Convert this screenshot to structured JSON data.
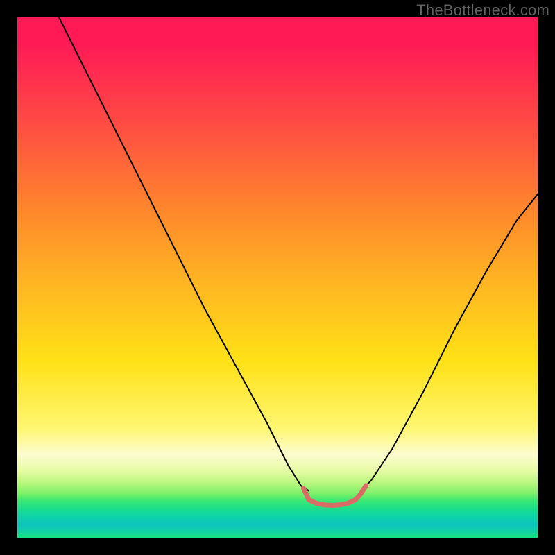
{
  "watermark": "TheBottleneck.com",
  "chart_data": {
    "type": "line",
    "title": "",
    "xlabel": "",
    "ylabel": "",
    "xlim": [
      0,
      100
    ],
    "ylim": [
      0,
      100
    ],
    "grid": false,
    "legend": false,
    "gradient_stops": [
      {
        "pos": 0,
        "color": "#ff1a56"
      },
      {
        "pos": 0.2,
        "color": "#ff4a44"
      },
      {
        "pos": 0.38,
        "color": "#ff8a2b"
      },
      {
        "pos": 0.5,
        "color": "#ffb223"
      },
      {
        "pos": 0.66,
        "color": "#ffe116"
      },
      {
        "pos": 0.79,
        "color": "#fff672"
      },
      {
        "pos": 0.84,
        "color": "#fcfccf"
      },
      {
        "pos": 0.87,
        "color": "#e8fba6"
      },
      {
        "pos": 0.895,
        "color": "#b9f77e"
      },
      {
        "pos": 0.915,
        "color": "#7df069"
      },
      {
        "pos": 0.93,
        "color": "#38e874"
      },
      {
        "pos": 0.945,
        "color": "#19de8e"
      },
      {
        "pos": 0.96,
        "color": "#0fd3a9"
      },
      {
        "pos": 0.975,
        "color": "#0ec4be"
      },
      {
        "pos": 1.0,
        "color": "#18e279"
      }
    ],
    "series": [
      {
        "name": "black-curve-left",
        "stroke": "#000000",
        "stroke_width": 2,
        "x": [
          8,
          12,
          18,
          24,
          30,
          36,
          42,
          48,
          52,
          54.5,
          56
        ],
        "y": [
          100,
          92,
          80,
          68,
          56,
          44,
          33,
          22,
          14,
          10,
          9
        ]
      },
      {
        "name": "black-curve-right",
        "stroke": "#000000",
        "stroke_width": 2,
        "x": [
          66,
          68,
          72,
          78,
          84,
          90,
          96,
          100
        ],
        "y": [
          9,
          11,
          17,
          28,
          40,
          51,
          61,
          66
        ]
      },
      {
        "name": "pink-bottom-segment",
        "stroke": "#d96d66",
        "stroke_width": 7,
        "x": [
          55,
          56,
          57.5,
          59,
          60.5,
          62,
          63.5,
          65,
          66,
          67
        ],
        "y": [
          9.5,
          7.3,
          6.6,
          6.3,
          6.2,
          6.3,
          6.6,
          7.3,
          8.4,
          10
        ]
      }
    ]
  }
}
